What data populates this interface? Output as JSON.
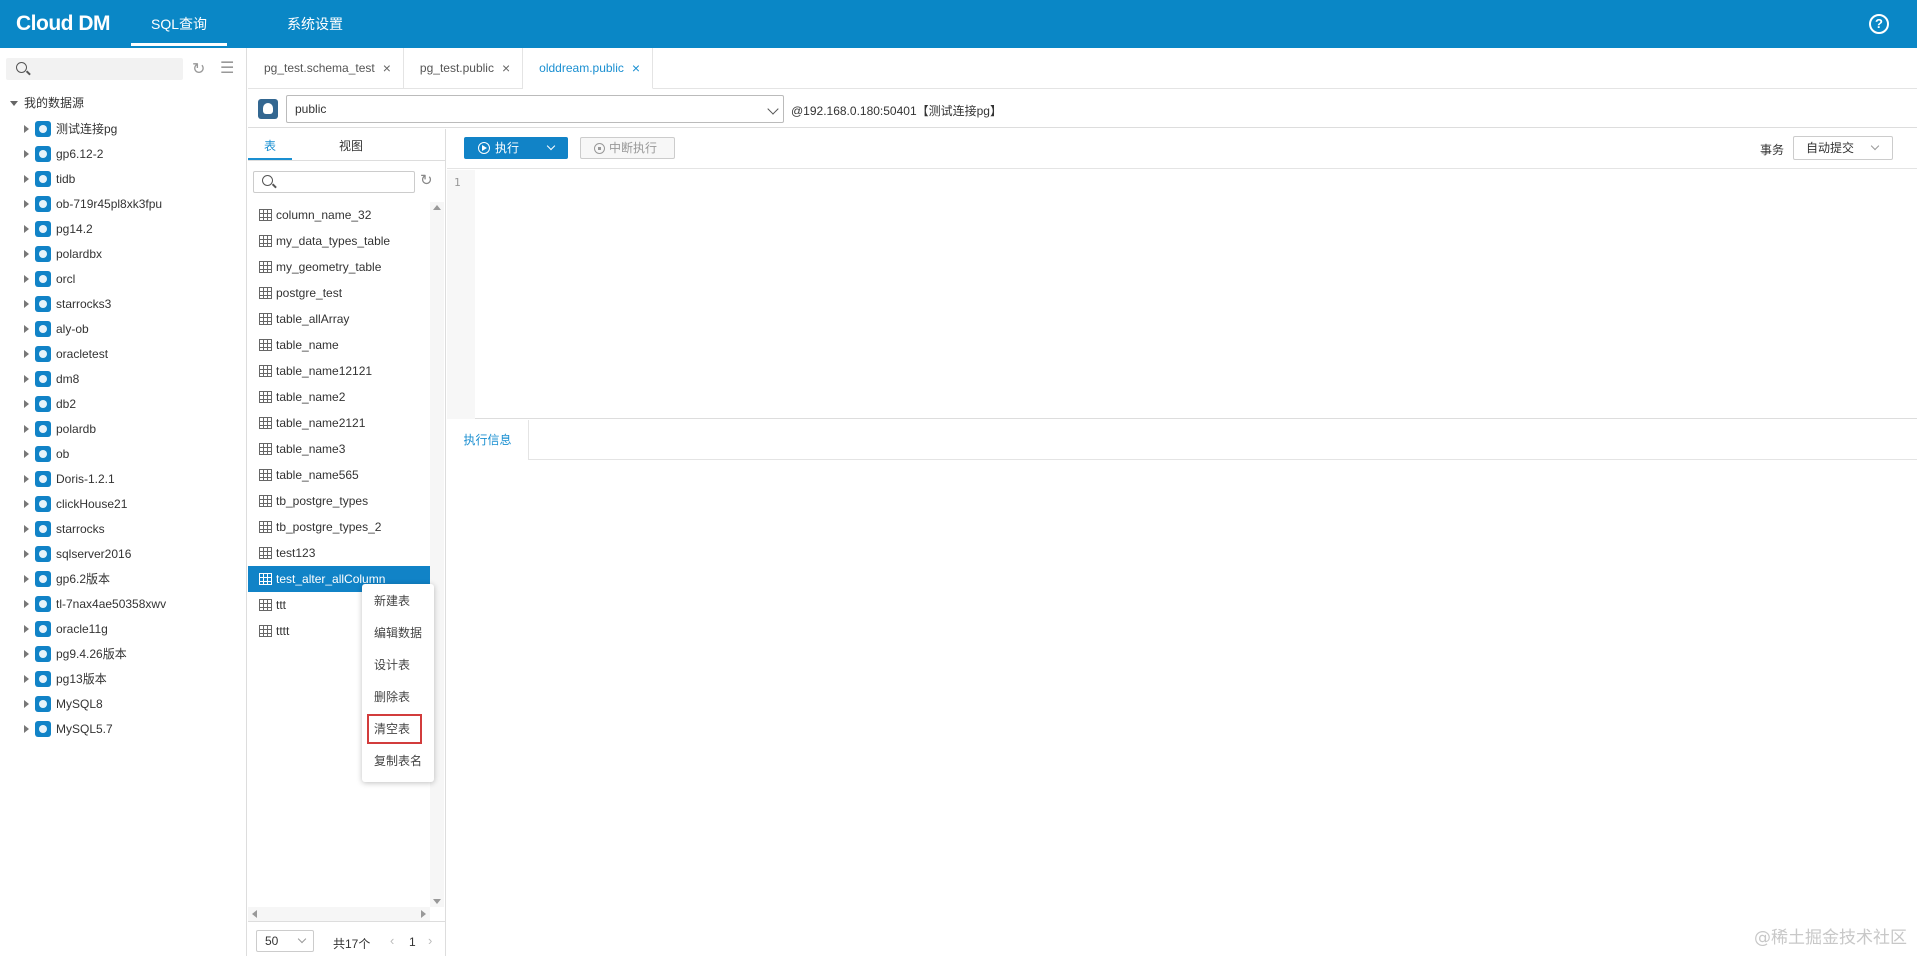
{
  "header": {
    "logo": "Cloud DM",
    "nav": [
      {
        "label": "SQL查询",
        "active": true
      },
      {
        "label": "系统设置",
        "active": false
      }
    ],
    "help_icon": "?"
  },
  "sidebar": {
    "root_label": "我的数据源",
    "datasources": [
      "测试连接pg",
      "gp6.12-2",
      "tidb",
      "ob-719r45pl8xk3fpu",
      "pg14.2",
      "polardbx",
      "orcl",
      "starrocks3",
      "aly-ob",
      "oracletest",
      "dm8",
      "db2",
      "polardb",
      "ob",
      "Doris-1.2.1",
      "clickHouse21",
      "starrocks",
      "sqlserver2016",
      "gp6.2版本",
      "tl-7nax4ae50358xwv",
      "oracle11g",
      "pg9.4.26版本",
      "pg13版本",
      "MySQL8",
      "MySQL5.7"
    ]
  },
  "tabs": [
    {
      "label": "pg_test.schema_test",
      "active": false
    },
    {
      "label": "pg_test.public",
      "active": false
    },
    {
      "label": "olddream.public",
      "active": true
    }
  ],
  "schema": {
    "selected": "public",
    "connection": "@192.168.0.180:50401【测试连接pg】"
  },
  "table_panel": {
    "tabs": [
      "表",
      "视图"
    ],
    "tables": [
      "column_name_32",
      "my_data_types_table",
      "my_geometry_table",
      "postgre_test",
      "table_allArray",
      "table_name",
      "table_name12121",
      "table_name2",
      "table_name2121",
      "table_name3",
      "table_name565",
      "tb_postgre_types",
      "tb_postgre_types_2",
      "test123",
      "test_alter_allColumn",
      "ttt",
      "tttt"
    ],
    "selected_index": 14,
    "pager": {
      "page_size": "50",
      "total": "共17个",
      "prev": "‹",
      "page": "1",
      "next": "›"
    }
  },
  "context_menu": {
    "items": [
      "新建表",
      "编辑数据",
      "设计表",
      "删除表",
      "清空表",
      "复制表名"
    ],
    "highlighted_index": 4
  },
  "toolbar": {
    "execute": "执行",
    "stop": "中断执行",
    "transaction_label": "事务",
    "transaction_mode": "自动提交"
  },
  "editor": {
    "line_number": "1"
  },
  "results": {
    "tab": "执行信息"
  },
  "watermark": "@稀土掘金技术社区"
}
